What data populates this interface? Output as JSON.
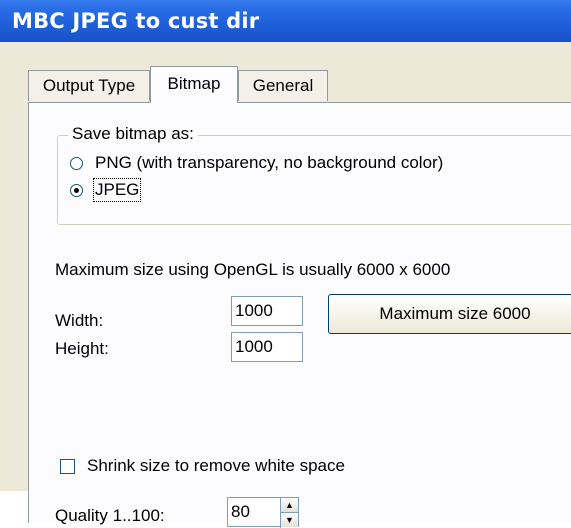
{
  "window": {
    "title": "MBC JPEG to cust dir"
  },
  "tabs": [
    {
      "label": "Output Type"
    },
    {
      "label": "Bitmap",
      "active": true
    },
    {
      "label": "General"
    }
  ],
  "save_bitmap": {
    "legend": "Save bitmap as:",
    "options": [
      {
        "label": "PNG (with transparency, no background color)",
        "checked": false
      },
      {
        "label": "JPEG",
        "checked": true
      }
    ]
  },
  "info_text": "Maximum size using OpenGL is usually 6000 x 6000",
  "size": {
    "width_label": "Width:",
    "width_value": "1000",
    "height_label": "Height:",
    "height_value": "1000",
    "max_button_label": "Maximum size 6000"
  },
  "shrink": {
    "label": "Shrink size to remove white space",
    "checked": false
  },
  "quality": {
    "label": "Quality 1..100:",
    "value": "80"
  },
  "colors": {
    "titlebar": "#1e5fd9",
    "panel": "#fcfcfe",
    "dialog": "#ece9d8"
  },
  "icons": [
    "spin-up-icon",
    "spin-down-icon"
  ]
}
